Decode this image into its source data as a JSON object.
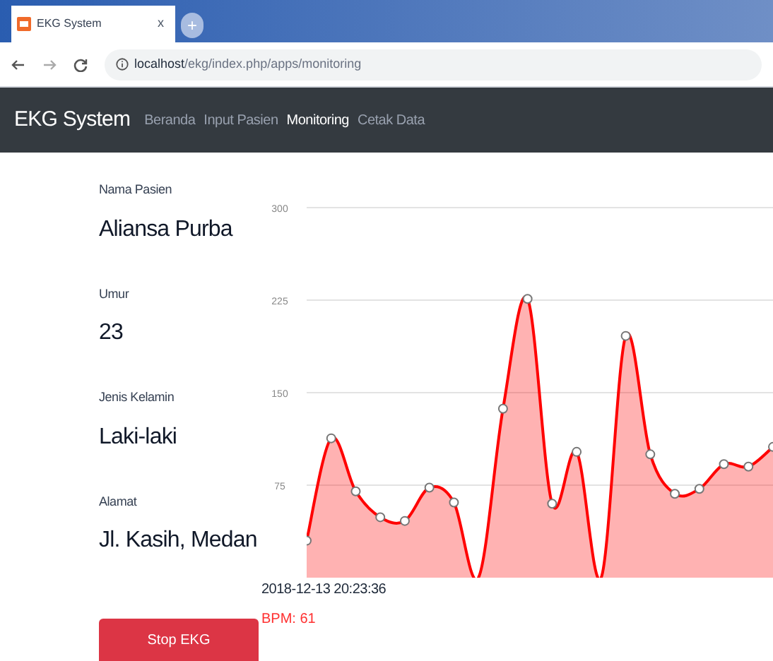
{
  "browser": {
    "tab_title": "EKG System",
    "tab_close": "x",
    "new_tab": "+",
    "url_host": "localhost",
    "url_path": "/ekg/index.php/apps/monitoring"
  },
  "navbar": {
    "brand": "EKG System",
    "items": [
      {
        "label": "Beranda",
        "selected": false
      },
      {
        "label": "Input Pasien",
        "selected": false
      },
      {
        "label": "Monitoring",
        "selected": true
      },
      {
        "label": "Cetak Data",
        "selected": false
      }
    ]
  },
  "patient": [
    {
      "label": "Nama Pasien",
      "value": "Aliansa Purba"
    },
    {
      "label": "Umur",
      "value": "23"
    },
    {
      "label": "Jenis Kelamin",
      "value": "Laki-laki"
    },
    {
      "label": "Alamat",
      "value": "Jl. Kasih, Medan"
    }
  ],
  "stop_button": "Stop EKG",
  "chart": {
    "chart_data": {
      "type": "area",
      "ylim": [
        0,
        300
      ],
      "yticks": [
        75,
        150,
        225,
        300
      ],
      "grid": true,
      "series": [
        {
          "color": "#ff0000",
          "values": [
            30,
            113,
            70,
            49,
            46,
            73,
            61,
            0,
            137,
            226,
            60,
            102,
            0,
            196,
            100,
            68,
            72,
            92,
            90,
            106
          ]
        }
      ]
    }
  },
  "timestamp": "2018-12-13 20:23:36",
  "bpm": "BPM: 61"
}
